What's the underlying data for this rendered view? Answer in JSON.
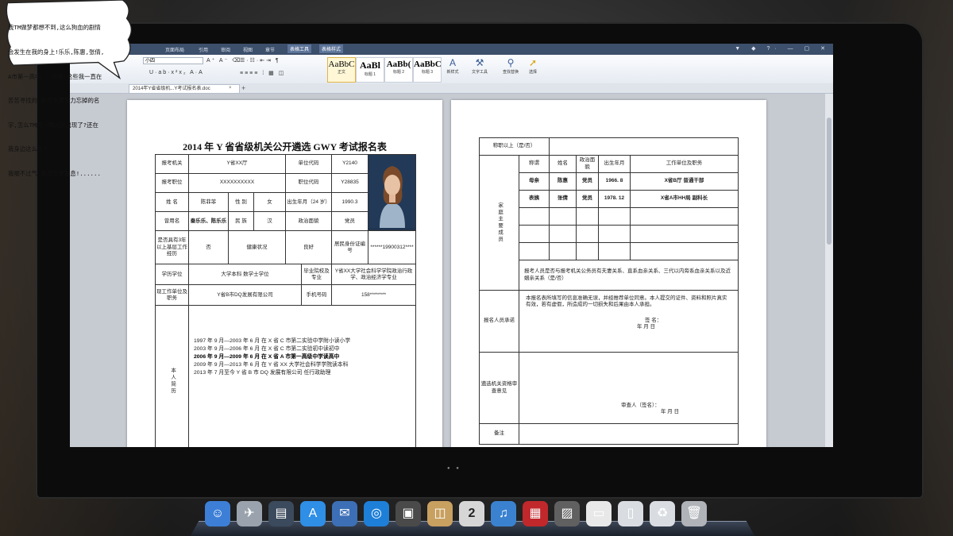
{
  "speech_bubble": {
    "lines": [
      "我TM做梦都想不到,这么狗血的剧情",
      "会发生在我的身上!乐乐,陈惠,张倩,",
      "A市第一高中...我操!这些我一直在",
      "苦苦寻找的,我现在要努力忘掉的名",
      "字,怎么TM的一瞬间就出现了?还在",
      "我身边这么久?",
      "我喘不过气,我感觉要窒息!......"
    ]
  },
  "menubar": {
    "tabs": [
      "页面布局",
      "引用",
      "审阅",
      "视图",
      "章节",
      "表格工具",
      "表格样式"
    ]
  },
  "ribbon": {
    "font_size": "小四",
    "styles": [
      {
        "sample": "AaBbC",
        "label": "正文"
      },
      {
        "sample": "AaBl",
        "label": "标题 1"
      },
      {
        "sample": "AaBb(",
        "label": "标题 2"
      },
      {
        "sample": "AaBbC",
        "label": "标题 3"
      }
    ],
    "buttons": {
      "new_style": "新样式",
      "text_tools": "文字工具",
      "find_replace": "查找替换",
      "select": "选择"
    }
  },
  "doc_tab": {
    "name": "2014年Y省省级机...Y考试报名表.doc",
    "close": "×",
    "add": "+"
  },
  "form_page1": {
    "title": "2014 年 Y 省省级机关公开遴选 GWY 考试报名表",
    "labels": {
      "apply_org": "报考机关",
      "org_code": "单位代码",
      "apply_post": "报考职位",
      "post_code": "职位代码",
      "name": "姓 名",
      "gender": "性 别",
      "birth": "出生年月（24 岁）",
      "former_name": "曾用名",
      "ethnicity": "民 族",
      "political": "政治面貌",
      "base_exp": "是否具有3年以上基层工作经历",
      "health": "健康状况",
      "id_no": "居民身份证编号",
      "education": "学历学位",
      "school": "毕业院校及专业",
      "current_job": "现工作单位及职务",
      "phone": "手机号码",
      "resume": "本人简历"
    },
    "values": {
      "apply_org": "Y省XX厅",
      "org_code": "Y2140",
      "apply_post": "XXXXXXXXXX",
      "post_code": "Y28835",
      "name": "陈菲菲",
      "gender": "女",
      "birth": "1990.3",
      "former_name": "秦乐乐、陈乐乐",
      "ethnicity": "汉",
      "political": "党员",
      "base_exp": "否",
      "health": "良好",
      "id_no": "******19900312****",
      "education": "大学本科 数学士学位",
      "school": "Y省XX大学社会科学学院政治行政学、政治经济学专业",
      "current_job": "Y省B市DQ发展有限公司",
      "phone": "158********"
    },
    "resume_lines": [
      {
        "text": "1997 年 9 月—2003 年 6 月   在 X 省 C 市第二实验中学附小读小学",
        "bold": false
      },
      {
        "text": "2003 年 9 月—2006 年 6 月   在 X 省 C 市第二实验初中读初中",
        "bold": false
      },
      {
        "text": "2006 年 9 月—2009 年 6 月   在 X 省 A 市第一高级中学读高中",
        "bold": true
      },
      {
        "text": "2009 年 9 月—2013 年 6 月   在 Y 省 XX 大学社会科学学院读本科",
        "bold": false
      },
      {
        "text": "2013 年 7 月至今 Y 省 B 市 DQ 发展有限公司 任行政助理",
        "bold": false
      }
    ]
  },
  "form_page2": {
    "title_row": "称职以上（是/否）",
    "family_label": "家庭主要成员",
    "family_headers": [
      "称谓",
      "姓名",
      "政治面貌",
      "出生年月",
      "工作单位及职务"
    ],
    "family_rows": [
      [
        "母亲",
        "陈惠",
        "党员",
        "1966. 8",
        "X省B厅 普通干部"
      ],
      [
        "表姨",
        "张倩",
        "党员",
        "1978. 12",
        "X省A市HH局 副科长"
      ]
    ],
    "relation_question": "报考人员是否与报考机关公务员有夫妻关系、直系血亲关系、三代以内旁系血亲关系以及近姻亲关系（是/否）",
    "relation_answer": "否",
    "pledge_label": "报名人员承诺",
    "pledge_text": "本报名表所填写的信息准确无误，并经推荐单位同意。本人提交的证件、资料和照片真实有效，若有虚假，所造成的一切损失和后果由本人承担。",
    "sign": "签    名：",
    "date": "年    月    日",
    "review_label": "遴选机关资格审查意见",
    "reviewer": "审查人（签名）：",
    "review_date": "年    月    日",
    "remark_label": "备注"
  },
  "dock": {
    "icons": [
      "finder-icon",
      "launchpad-icon",
      "mission-control-icon",
      "app-store-icon",
      "mail-icon",
      "safari-icon",
      "facetime-icon",
      "contacts-icon",
      "calendar-icon",
      "itunes-icon",
      "photo-booth-icon",
      "preview-icon",
      "documents-icon",
      "file-icon",
      "recycle-icon",
      "trash-icon"
    ],
    "calendar_day": "2"
  }
}
